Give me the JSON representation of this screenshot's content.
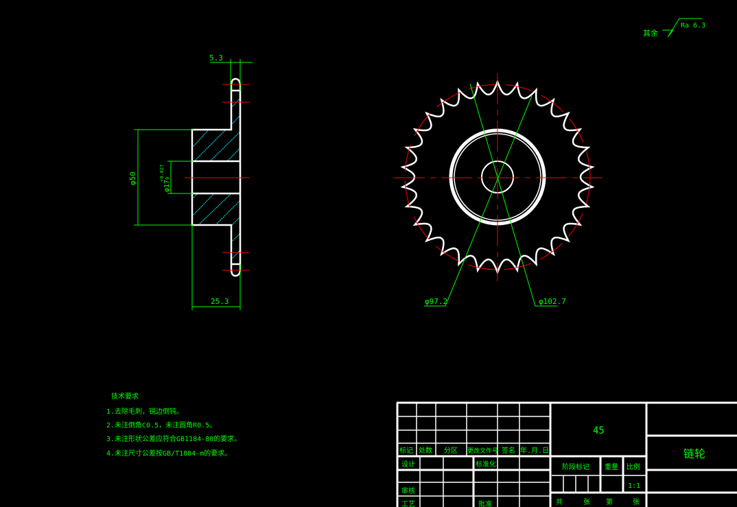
{
  "roughness": {
    "label": "其余",
    "value": "Ra 6.3"
  },
  "section_view": {
    "dim_plate_width": "5.3",
    "dim_hub_length": "25.3",
    "dim_hub_diameter": "φ50",
    "dim_bore": "φ17",
    "dim_bore_tol": "+0.027",
    "dim_bore_tol_low": "0"
  },
  "front_view": {
    "teeth": 30,
    "dim_left": "φ97.2",
    "dim_right": "φ102.7"
  },
  "tech_requirements": {
    "title": "技术要求",
    "items": [
      "1.去除毛刺，锐边倒钝。",
      "2.未注倒角C0.5，未注圆角R0.5。",
      "3.未注形状公差应符合GB1184-80的要求。",
      "4.未注尺寸公差按GB/T1804-m的要求。"
    ]
  },
  "title_block": {
    "material": "45",
    "part_name": "链轮",
    "headers": [
      "标记",
      "处数",
      "分区",
      "更改文件号",
      "签名",
      "年.月.日"
    ],
    "design": "设计",
    "standardization": "标准化",
    "review": "审核",
    "process": "工艺",
    "approve": "批准",
    "stage_mark": "阶段标记",
    "weight": "重量",
    "scale": "比例",
    "scale_value": "1:1",
    "total": "共",
    "sheets": "张",
    "sheet_no": "第",
    "sheets2": "张"
  }
}
